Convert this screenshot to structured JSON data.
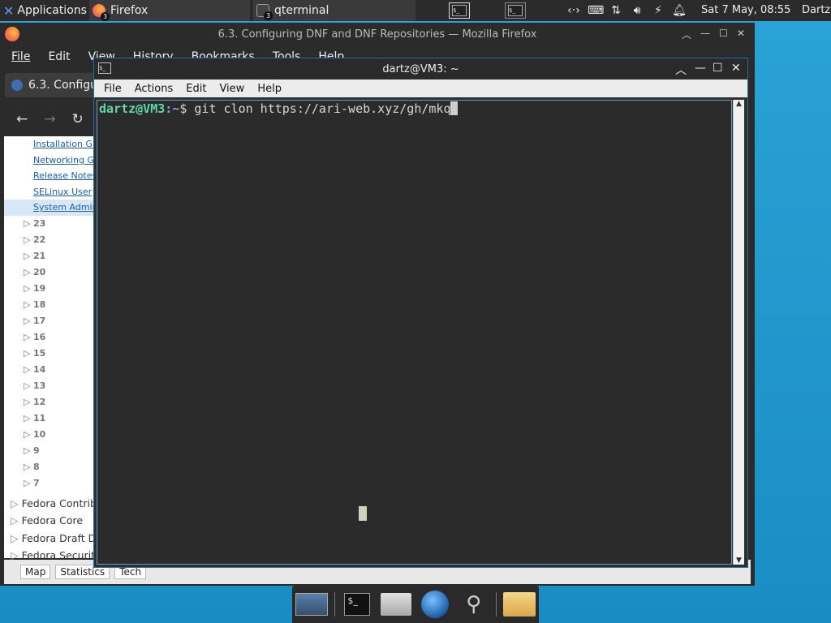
{
  "panel": {
    "apps_label": "Applications",
    "tasks": [
      {
        "label": "Firefox",
        "badge": "3"
      },
      {
        "label": "qterminal",
        "badge": "3"
      }
    ],
    "workspace_glyph": "$_",
    "clock": "Sat 7 May, 08:55",
    "user": "Dartz"
  },
  "firefox": {
    "title": "6.3. Configuring DNF and DNF Repositories — Mozilla Firefox",
    "menu": [
      "File",
      "Edit",
      "View",
      "History",
      "Bookmarks",
      "Tools",
      "Help"
    ],
    "tab_label": "6.3. Configu",
    "sidebar_links": [
      "Installation Gu",
      "Networking Gu",
      "Release Notes",
      "SELinux User",
      "System Admini"
    ],
    "versions": [
      "23",
      "22",
      "21",
      "20",
      "19",
      "18",
      "17",
      "16",
      "15",
      "14",
      "13",
      "12",
      "11",
      "10",
      "9",
      "8",
      "7"
    ],
    "groups": [
      "Fedora Contrib",
      "Fedora Core",
      "Fedora Draft D",
      "Fedora Securit"
    ],
    "bottom_tabs": [
      "Map",
      "Statistics",
      "Tech"
    ]
  },
  "terminal": {
    "title": "dartz@VM3: ~",
    "menu": [
      "File",
      "Actions",
      "Edit",
      "View",
      "Help"
    ],
    "prompt_user": "dartz@VM3",
    "prompt_path": ":~",
    "prompt_symbol": "$ ",
    "command": "git clon https://ari-web.xyz/gh/mkq"
  },
  "colors": {
    "desktop": "#1a8cc4",
    "prompt_user": "#5fd7a7",
    "prompt_path": "#7aa6da"
  }
}
